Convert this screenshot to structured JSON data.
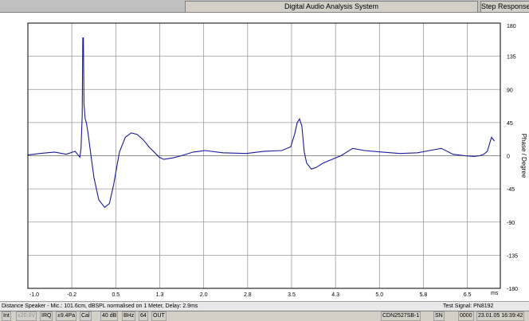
{
  "window": {
    "title": "Digital Audio Analysis System",
    "right_panel_title": "Step Response"
  },
  "chart_data": {
    "type": "line",
    "xlabel": "ms",
    "ylabel": "Phase / Degree",
    "xlim": [
      -1.0,
      7.0
    ],
    "ylim": [
      -180,
      180
    ],
    "x_tick_labels": [
      "-1.0",
      "-0.2",
      "0.5",
      "1.3",
      "2.0",
      "2.8",
      "3.5",
      "4.3",
      "5.0",
      "5.8",
      "6.5"
    ],
    "y_tick_labels": [
      "180",
      "135",
      "90",
      "45",
      "0",
      "-45",
      "-90",
      "-135",
      "-180"
    ],
    "grid": true,
    "series": [
      {
        "color": "#1a1a9a",
        "x": [
          -1.0,
          -0.8,
          -0.55,
          -0.35,
          -0.2,
          -0.12,
          -0.1,
          -0.08,
          -0.07,
          -0.06,
          -0.05,
          -0.04,
          -0.03,
          -0.01,
          0.02,
          0.06,
          0.12,
          0.2,
          0.3,
          0.38,
          0.45,
          0.55,
          0.65,
          0.75,
          0.85,
          0.95,
          1.05,
          1.15,
          1.22,
          1.3,
          1.45,
          1.6,
          1.8,
          2.0,
          2.3,
          2.7,
          3.0,
          3.3,
          3.45,
          3.52,
          3.56,
          3.6,
          3.64,
          3.68,
          3.72,
          3.8,
          3.88,
          4.0,
          4.15,
          4.3,
          4.5,
          4.7,
          5.0,
          5.3,
          5.6,
          5.8,
          6.0,
          6.2,
          6.4,
          6.55,
          6.65,
          6.72,
          6.78,
          6.85,
          6.9
        ],
        "y": [
          1,
          3,
          5,
          2,
          6,
          -2,
          10,
          55,
          160,
          160,
          70,
          60,
          50,
          45,
          30,
          5,
          -30,
          -60,
          -70,
          -65,
          -40,
          5,
          25,
          31,
          29,
          22,
          12,
          4,
          -2,
          -5,
          -3,
          0,
          5,
          7,
          4,
          3,
          6,
          7,
          12,
          30,
          45,
          50,
          40,
          5,
          -10,
          -18,
          -16,
          -10,
          -5,
          0,
          10,
          7,
          5,
          3,
          4,
          7,
          10,
          2,
          0,
          -1,
          0,
          2,
          6,
          25,
          20
        ]
      }
    ]
  },
  "info_bar": {
    "left_text": "Distance Speaker - Mic.: 101.6cm, dBSPL normalised on 1 Meter, Delay: 2.9ms",
    "right_text": "Test Signal: PN8192"
  },
  "status_bar": {
    "items": [
      "Int",
      "±20.0V",
      "IRQ",
      "±9.4Pa",
      "Cal",
      "40 dB",
      "BHz",
      "64",
      "OUT"
    ],
    "device": "CDN2527SB-1",
    "sn_label": "SN",
    "sn_value": "0000",
    "datetime": "23.01.05  16:39:42"
  }
}
